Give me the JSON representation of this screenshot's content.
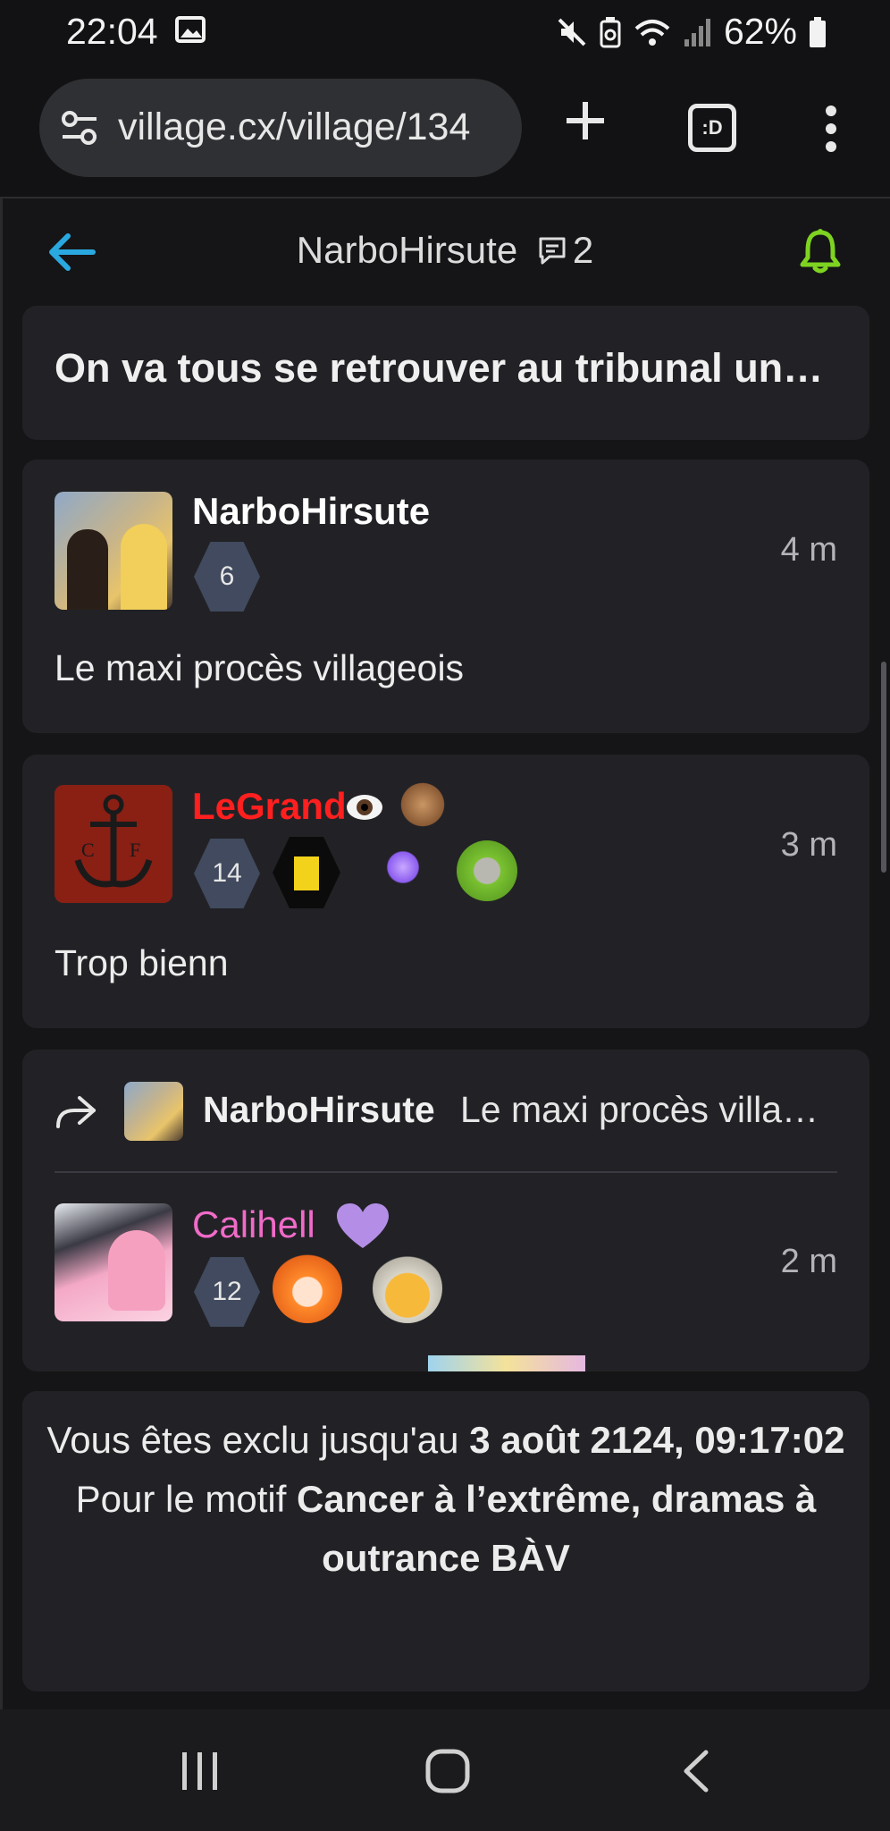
{
  "status_bar": {
    "time": "22:04",
    "battery": "62%"
  },
  "browser": {
    "url": "village.cx/village/134",
    "tabs_label": ":D"
  },
  "topic": {
    "author": "NarboHirsute",
    "comment_count": "2",
    "title": "On va tous se retrouver au tribunal un…"
  },
  "posts": [
    {
      "username": "NarboHirsute",
      "level": "6",
      "time": "4 m",
      "message": "Le maxi procès villageois",
      "name_color": "#ffffff"
    },
    {
      "username": "LeGrand",
      "level": "14",
      "time": "3 m",
      "message": "Trop bienn",
      "name_color": "#ff1f1f"
    },
    {
      "reply_to_user": "NarboHirsute",
      "reply_to_text": "Le maxi procès villa…",
      "username": "Calihell",
      "level": "12",
      "time": "2 m",
      "name_color": "#f06bc8"
    }
  ],
  "ban": {
    "prefix": "Vous êtes exclu jusqu'au ",
    "until": "3 août 2124, 09:17:02",
    "reason_prefix": "Pour le motif ",
    "reason": "Cancer à l’extrême, dramas à outrance BÀV"
  },
  "colors": {
    "accent_blue": "#2aa8e0",
    "bell_green": "#7ed321",
    "badge": "#414a5e"
  },
  "icons": [
    "image-icon",
    "mute-icon",
    "recycle-icon",
    "wifi-icon",
    "signal-icon",
    "battery-icon",
    "tune-icon",
    "plus-icon",
    "tabs-icon",
    "menu-icon",
    "back-arrow-icon",
    "comment-icon",
    "bell-icon",
    "reply-arrow-icon",
    "eye-icon",
    "recents-icon",
    "home-icon",
    "back-icon"
  ]
}
